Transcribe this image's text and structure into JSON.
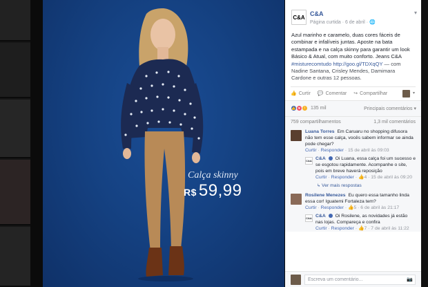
{
  "photo": {
    "caption_title": "Calça skinny",
    "currency": "R$",
    "price": "59,99"
  },
  "post": {
    "page_name": "C&A",
    "page_logo_text": "C&A",
    "meta": "Página curtida · 6 de abril · 🌐",
    "text": "Azul marinho e caramelo, duas cores fáceis de combinar e infalíveis juntas. Aposte na bata estampada e na calça skinny para garantir um look Básico & Atual, com muito conforto. Jeans C&A",
    "hashtag": "#misturecomtudo",
    "link": "http://goo.gl/TDXqQY",
    "tagged": "— com Nadine Santana, Crisley Mendes, Damimara Cardone e outras 12 pessoas."
  },
  "actions": {
    "like": "Curtir",
    "comment": "Comentar",
    "share": "Compartilhar"
  },
  "stats": {
    "reactions_count": "135 mil",
    "sort_label": "Principais comentários",
    "shares": "759 compartilhamentos",
    "comments": "1,3 mil comentários"
  },
  "comments": [
    {
      "author": "Luana Torres",
      "text": "Em Caruaru no shopping difusora não tem esse calça, vocês sabem informar se ainda pode chegar?",
      "like": "Curtir",
      "reply": "Responder",
      "date": "15 de abril às 09:03",
      "reply_item": {
        "author": "C&A",
        "text": "Oi Luana, essa calça foi um sucesso e se esgotou rapidamente. Acompanhe o site, pois em breve haverá reposição",
        "like": "Curtir",
        "reply": "Responder",
        "likes": "4",
        "date": "15 de abril às 09:20"
      },
      "more": "Ver mais respostas"
    },
    {
      "author": "Rosilene Menezes",
      "text": "Eu quero essa tamanho linda essa cor! Iguatemi Fortaleza tem?",
      "like": "Curtir",
      "reply": "Responder",
      "likes": "5",
      "date": "6 de abril às 21:17",
      "reply_item": {
        "author": "C&A",
        "text": "Oi Rosilene, as novidades já estão nas lojas. Compareça e confira",
        "like": "Curtir",
        "reply": "Responder",
        "likes": "7",
        "date": "7 de abril às 11:22"
      }
    }
  ],
  "write": {
    "placeholder": "Escreva um comentário..."
  },
  "colors": {
    "photo_bg": "#154283",
    "fb_link": "#365899",
    "fb_blue": "#4267b2"
  }
}
